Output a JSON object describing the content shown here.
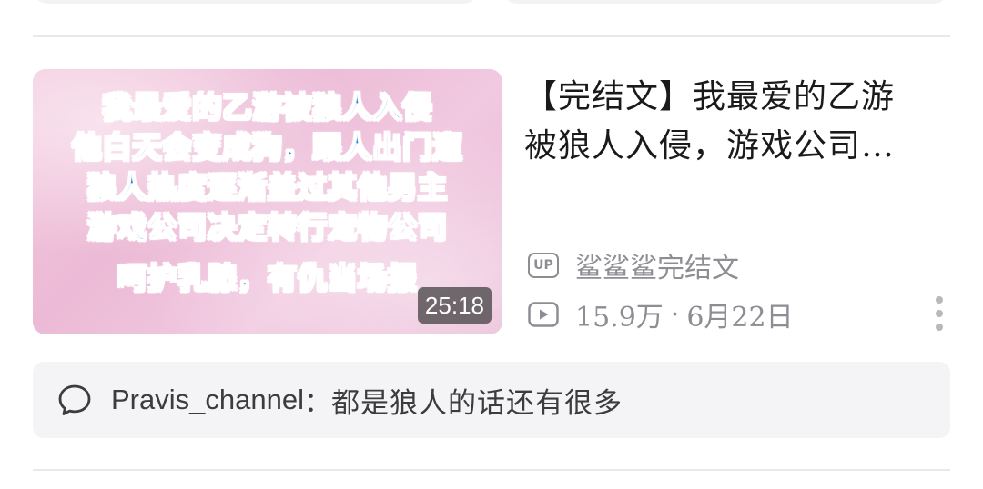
{
  "video": {
    "thumbnail_lines": [
      "我最爱的乙游被狼人入侵",
      "他白天会变成狗，跟人出门遛",
      "狼人热度逐渐盖过其他男主",
      "游戏公司决定转行宠物公司",
      "呵护乳腺，有仇当场报"
    ],
    "duration": "25:18",
    "title_line1": "【完结文】我最爱的乙游",
    "title_line2": "被狼人入侵，游戏公司…",
    "up_badge": "UP",
    "author": "鲨鲨鲨完结文",
    "views": "15.9万",
    "separator": "·",
    "date": "6月22日"
  },
  "comment": {
    "user": "Pravis_channel",
    "colon": "：",
    "text": "都是狼人的话还有很多"
  },
  "icons": {
    "up": "up-badge-icon",
    "play": "play-icon",
    "more": "more-vertical-icon",
    "comment": "comment-bubble-icon"
  }
}
